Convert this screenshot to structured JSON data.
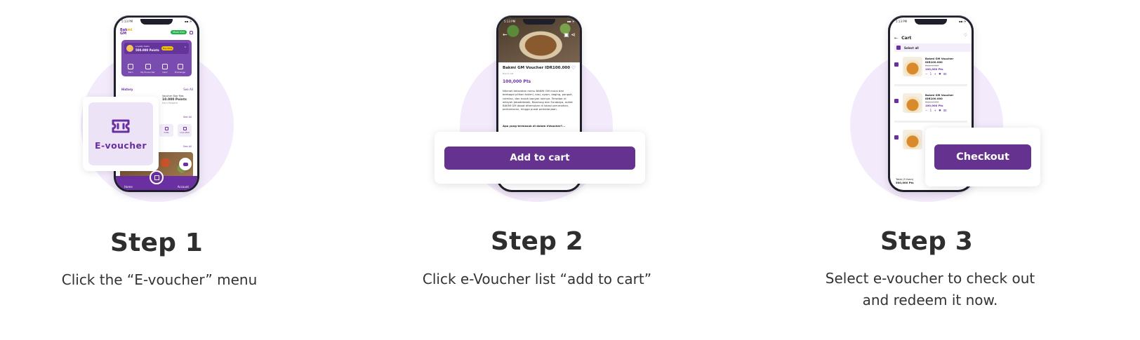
{
  "steps": [
    {
      "title": "Step 1",
      "description": "Click the “E-voucher” menu",
      "callout_label": "E-voucher",
      "phone": {
        "status_time": "5:13 PM",
        "logo": "Bakmi GM",
        "top_pill": "Mulai Kini",
        "loyalty_title": "Loyalty Saldo",
        "loyalty_points": "500.000 Points",
        "buy_label": "Buy Now",
        "menu_items": [
          "Earn",
          "My E-voucher",
          "Card",
          "Exchange"
        ],
        "history_label": "History",
        "see_all": "See All",
        "history_card_title": "Voucher Star Mas",
        "history_card_points": "10.000 Points",
        "history_card_sub": "Earn Reward",
        "grid_labels": [
          "Gifts",
          "Live Mall"
        ],
        "nav_home": "Home",
        "nav_account": "Account"
      }
    },
    {
      "title": "Step 2",
      "description": "Click e-Voucher list “add to cart”",
      "button_label": "Add to cart",
      "phone": {
        "voucher_title": "Bakmi GM Voucher IDR100.000",
        "voucher_sub": "Bakmi GM",
        "points": "100,000 Pts",
        "body": "Nikmati kelezatan menu BAKMI GM mulai dari berbagai pilihan bakmi, nasi, ayam, daging, pangsit, cemilan, dan masih banyak lainnya. Tersebar di wilayah Jabodetabek, Bandung dan Surabaya, outlet BAKMI GM dapat ditemukan di lokasi perumahan, perkantoran, hingga pusat perbelanjaan.",
        "what_heading": "Apa yang termasuk di dalam eVoucher?..."
      }
    },
    {
      "title": "Step 3",
      "description_line1": "Select e-voucher to check out",
      "description_line2": "and redeem it now.",
      "button_label": "Checkout",
      "phone": {
        "header": "Cart",
        "select_all": "Select all",
        "items": [
          {
            "name": "Bakmi GM Voucher IDR100.000",
            "old_price": "Bakmi GM",
            "price": "100,000 Pts",
            "qty": "1"
          },
          {
            "name": "Bakmi GM Voucher IDR100.000",
            "old_price": "Bakmi GM",
            "price": "100,000 Pts",
            "qty": "1"
          }
        ],
        "total_label": "Total (5 Item)",
        "total_value": "500,000 Pts"
      }
    }
  ],
  "colors": {
    "brand_purple": "#65338f",
    "halo": "#f3eafb",
    "tile": "#ede3f6",
    "title_text": "#2e2e2e"
  },
  "icons": [
    "ticket-icon",
    "heart-icon",
    "back-arrow-icon",
    "share-icon",
    "bell-icon",
    "scan-icon",
    "home-icon",
    "account-icon",
    "trash-icon"
  ]
}
